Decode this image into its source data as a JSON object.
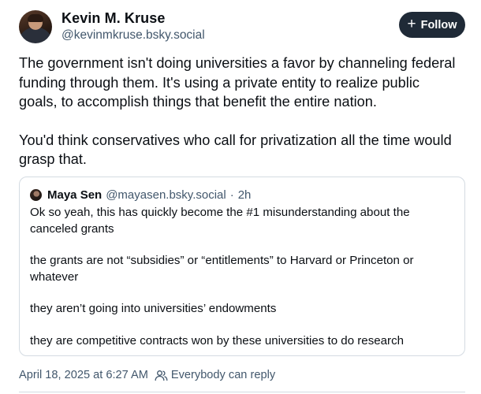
{
  "author": {
    "name": "Kevin M. Kruse",
    "handle": "@kevinmkruse.bsky.social",
    "avatar_icon": "author-avatar"
  },
  "follow_button": {
    "icon": "plus-icon",
    "label": "Follow"
  },
  "post": {
    "paragraphs": [
      "The government isn't doing universities a favor by channeling federal funding through them. It's using a private entity to realize public goals, to accomplish things that benefit the entire nation.",
      "You'd think conservatives who call for privatization all the time would grasp that."
    ]
  },
  "quote": {
    "author_name": "Maya Sen",
    "author_handle": "@mayasen.bsky.social",
    "separator": "·",
    "time": "2h",
    "paragraphs": [
      "Ok so yeah, this has quickly become the #1 misunderstanding about the canceled grants",
      "the grants are not “subsidies” or “entitlements” to Harvard or Princeton or whatever",
      "they aren’t going into universities’ endowments",
      "they are competitive contracts won by these universities to do research"
    ]
  },
  "meta": {
    "timestamp": "April 18, 2025 at 6:27 AM",
    "reply_icon": "people-icon",
    "reply_setting": "Everybody can reply"
  },
  "colors": {
    "text": "#0b0f14",
    "secondary": "#42576c",
    "follow_bg": "#1f2a37",
    "border": "#d4dbe2"
  }
}
